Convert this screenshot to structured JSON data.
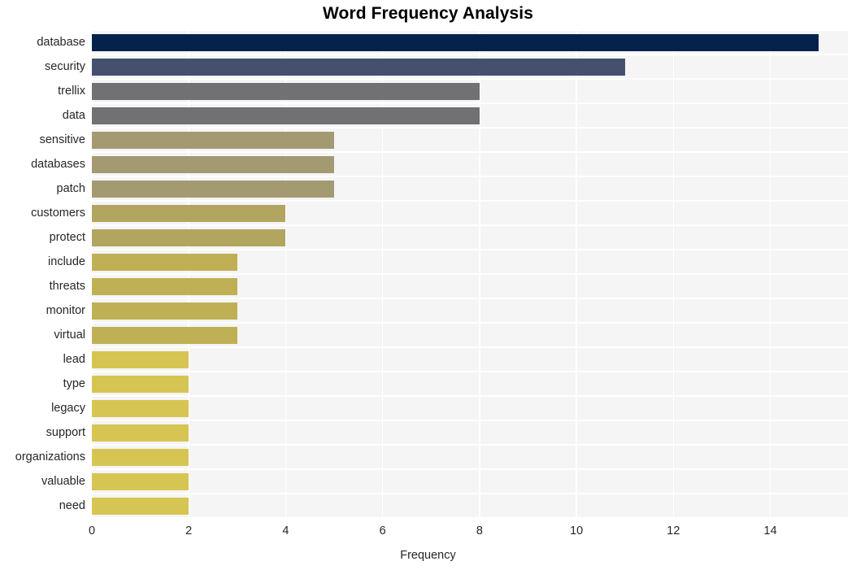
{
  "chart_data": {
    "type": "bar",
    "orientation": "horizontal",
    "title": "Word Frequency Analysis",
    "xlabel": "Frequency",
    "ylabel": "",
    "xlim": [
      0,
      15.6
    ],
    "ylim": [
      0,
      20
    ],
    "grid": true,
    "legend": null,
    "xticks": [
      "0",
      "2",
      "4",
      "6",
      "8",
      "10",
      "12",
      "14"
    ],
    "xtick_values": [
      0,
      2,
      4,
      6,
      8,
      10,
      12,
      14
    ],
    "categories": [
      "database",
      "security",
      "trellix",
      "data",
      "sensitive",
      "databases",
      "patch",
      "customers",
      "protect",
      "include",
      "threats",
      "monitor",
      "virtual",
      "lead",
      "type",
      "legacy",
      "support",
      "organizations",
      "valuable",
      "need"
    ],
    "values": [
      15,
      11,
      8,
      8,
      5,
      5,
      5,
      4,
      4,
      3,
      3,
      3,
      3,
      2,
      2,
      2,
      2,
      2,
      2,
      2
    ],
    "bar_colors": [
      "#04224c",
      "#454f6e",
      "#717073",
      "#717073",
      "#a49a72",
      "#a49a72",
      "#a49a72",
      "#b2a55f",
      "#b2a55f",
      "#c0b055",
      "#c0b055",
      "#c0b055",
      "#c0b055",
      "#d6c552",
      "#d6c552",
      "#d6c552",
      "#d6c552",
      "#d6c552",
      "#d6c552",
      "#d6c552"
    ],
    "colors": {
      "plot_background": "#f5f5f5",
      "figure_background": "#ffffff",
      "gridline": "#ffffff",
      "text": "#262626",
      "title": "#000000"
    }
  }
}
